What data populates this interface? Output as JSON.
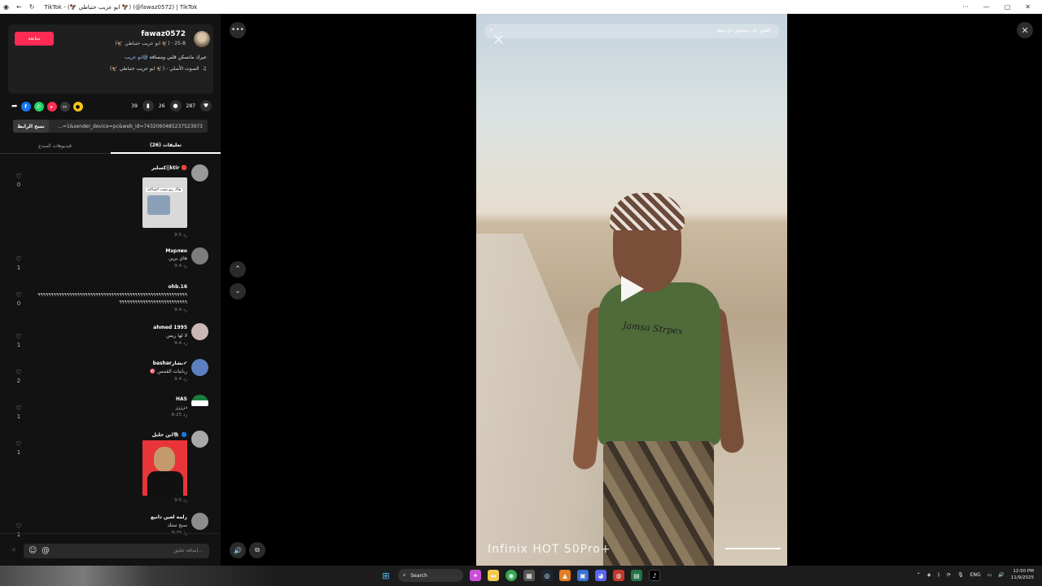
{
  "window": {
    "title": "TikTok - (🦅 ابو عريب حتباطي 🦅) (@fawaz0572) | TikTok",
    "controls": {
      "minimize": "—",
      "restore": "▢",
      "close": "✕"
    }
  },
  "author": {
    "username": "fawaz0572",
    "display_line": "(🦅 ابو عريب حتباطي 🦅) · 8-25",
    "follow_label": "متابعة",
    "caption_text": "عيرك مانسكن قلبي ومسافة ",
    "caption_mention": "@ابو عريب",
    "music": "الصوت الأصلي - (🦅 ابو عريب حتباطي 🦅)"
  },
  "stats": {
    "likes": "287",
    "comments": "26",
    "saves": "39"
  },
  "link": {
    "copy_label": "نسخ الرابط",
    "url": "...=1&sender_device=pc&web_id=7432060485237523973"
  },
  "tabs": [
    {
      "label": "تعليقات (26)",
      "active": true
    },
    {
      "label": "فيديوهات المبدع",
      "active": false
    }
  ],
  "comments": [
    {
      "name": "كسلير||ktir 🔴",
      "text": "",
      "meta": "9-5   رد",
      "likes": "0",
      "has_sticker": true,
      "sticker_text": "هاك ريو نسب الساكته"
    },
    {
      "name": "Мэрлин",
      "text": "هاي يرين",
      "meta": "9-4   رد",
      "likes": "1"
    },
    {
      "name": "ohb.16",
      "text": "٩٩٩٩٩٩٩٩٩٩٩٩٩٩٩٩٩٩٩٩٩٩٩٩٩٩٩٩٩٩٩٩٩٩٩٩٩٩٩٩٩٩٩٩٩٩٩٩٩٩٩٩٩٩٩٩٩",
      "text2": "٩٩٩٩٩٩٩٩٩٩٩٩٩٩٩٩٩٩٩٩٩٩٩٩٩٩",
      "meta": "9-4   رد",
      "likes": "0"
    },
    {
      "name": "ahmed 1995",
      "text": "لا لها ريس",
      "meta": "9-4   رد",
      "likes": "1"
    },
    {
      "name": "basharبشار✔",
      "text": "ربانيات القمس 🎯",
      "meta": "9-4   رد",
      "likes": "2"
    },
    {
      "name": "HAS",
      "text": "دزززز",
      "meta": "8-25   رد",
      "likes": "1"
    },
    {
      "name": "ابن خليل🐘 🔵",
      "text": "",
      "meta": "9-5   رد",
      "likes": "1",
      "has_dog": true
    },
    {
      "name": "زلمة لعين دانيع",
      "text": "سبح ستك",
      "meta": "8-25   رد",
      "likes": "1"
    }
  ],
  "comment_input": {
    "placeholder": "إضافة تعليق...",
    "emoji_icon": "☺",
    "mention_icon": "@"
  },
  "video": {
    "search_placeholder": "العثور على محتوى ذي صلة",
    "shirt_text": "Jamsa Strpex",
    "watermark": "Infinix  HOT 50Pro+"
  },
  "taskbar": {
    "search_label": "Search",
    "lang": "ENG",
    "time": "12:50 PM",
    "date": "11/9/2025"
  },
  "icons": {
    "more": "•••",
    "close": "✕",
    "up": "⌃",
    "down": "⌄",
    "sound": "🔊"
  }
}
